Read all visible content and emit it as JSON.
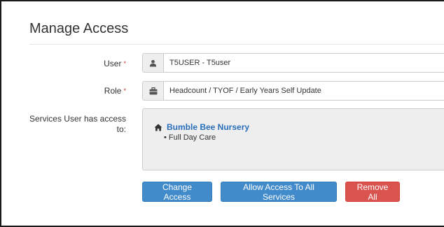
{
  "panel": {
    "title": "Manage Access"
  },
  "form": {
    "user": {
      "label": "User",
      "required_mark": "*",
      "value": "T5USER - T5user",
      "icon": "user-icon"
    },
    "role": {
      "label": "Role",
      "required_mark": "*",
      "value": "Headcount / TYOF / Early Years Self Update",
      "icon": "briefcase-icon"
    },
    "services": {
      "label_line1": "Services User has access",
      "label_line2": "to:",
      "items": [
        {
          "name": "Bumble Bee Nursery",
          "icon": "home-icon",
          "sub_items": [
            "Full Day Care"
          ]
        }
      ]
    }
  },
  "actions": {
    "change_access": "Change Access",
    "allow_all": "Allow Access To All Services",
    "remove_all": "Remove All"
  },
  "colors": {
    "primary": "#428bca",
    "danger": "#d9534f",
    "link": "#2a6ebb",
    "required": "#c9302c"
  }
}
